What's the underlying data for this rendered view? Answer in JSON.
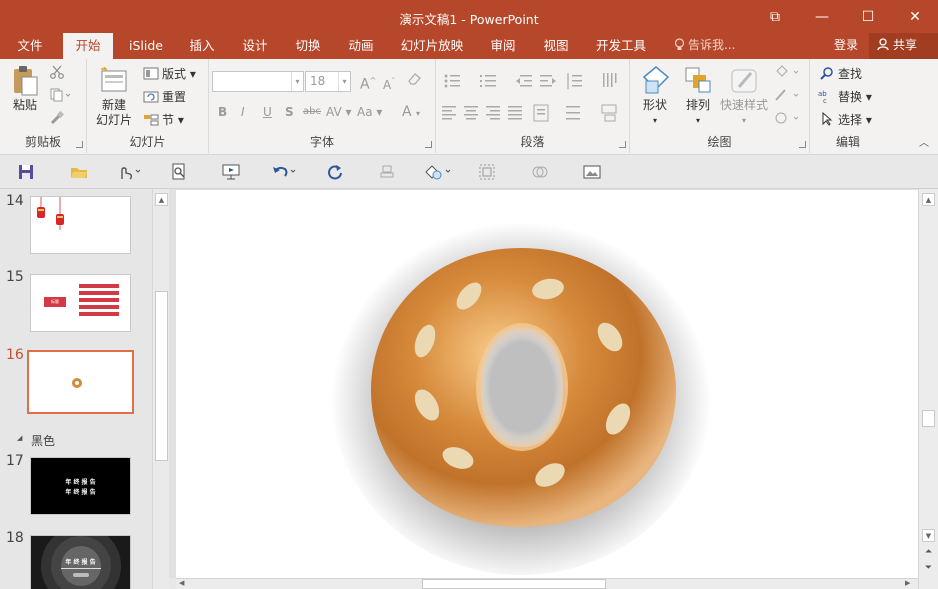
{
  "window": {
    "title": "演示文稿1 - PowerPoint",
    "btn_ribbon_opts": "⧉",
    "btn_minimize": "—",
    "btn_maximize": "☐",
    "btn_close": "✕"
  },
  "tabs": [
    {
      "label": "文件"
    },
    {
      "label": "开始"
    },
    {
      "label": "iSlide"
    },
    {
      "label": "插入"
    },
    {
      "label": "设计"
    },
    {
      "label": "切换"
    },
    {
      "label": "动画"
    },
    {
      "label": "幻灯片放映"
    },
    {
      "label": "审阅"
    },
    {
      "label": "视图"
    },
    {
      "label": "开发工具"
    }
  ],
  "tell_me": "告诉我...",
  "login": "登录",
  "share": "共享",
  "ribbon": {
    "clipboard": {
      "label": "剪贴板",
      "paste": "粘贴"
    },
    "slides": {
      "label": "幻灯片",
      "new_slide_1": "新建",
      "new_slide_2": "幻灯片",
      "layout": "版式",
      "reset": "重置",
      "section": "节"
    },
    "font": {
      "label": "字体",
      "font_size": "18",
      "bold": "B",
      "italic": "I",
      "underline": "U",
      "shadow": "S",
      "strike": "abc",
      "spacing": "AV",
      "case": "Aa",
      "grow": "A",
      "shrink": "A",
      "color": "A"
    },
    "paragraph": {
      "label": "段落"
    },
    "drawing": {
      "label": "绘图",
      "shape": "形状",
      "arrange": "排列",
      "quick_styles": "快速样式"
    },
    "editing": {
      "label": "编辑",
      "find": "查找",
      "replace": "替换",
      "select": "选择"
    }
  },
  "thumbnails": [
    {
      "number": "14"
    },
    {
      "number": "15"
    },
    {
      "number": "16"
    },
    {
      "number": "17",
      "line1": "年 终 报 告",
      "line2": "年 终 报 告"
    },
    {
      "number": "18",
      "line1": "年 终 报 告"
    }
  ],
  "section_name": "黑色",
  "slide15_badge": "标题",
  "colors": {
    "accent": "#b7472a",
    "selected_thumb": "#e06f49",
    "donut_main": "#d48a3c",
    "seed": "#ead9b3"
  }
}
